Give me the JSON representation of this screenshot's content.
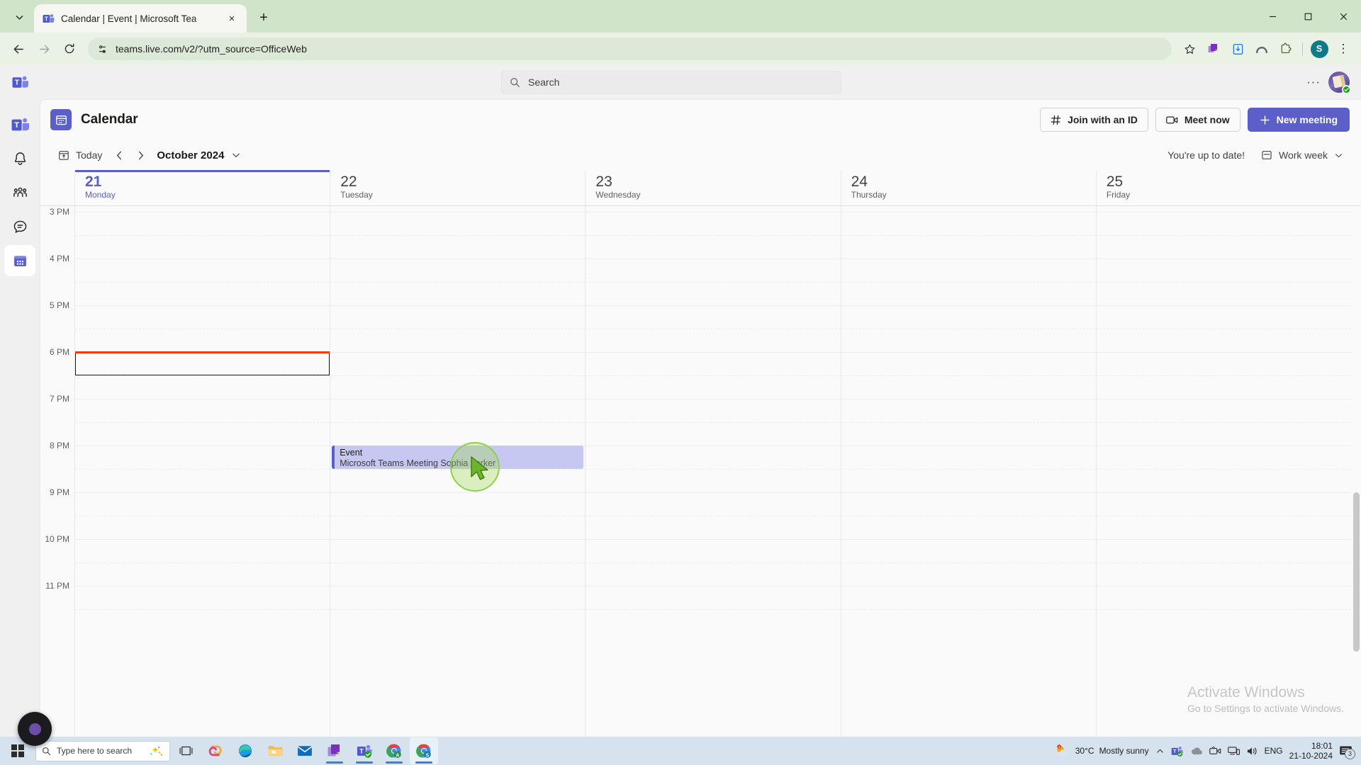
{
  "browser": {
    "tab": {
      "title": "Calendar | Event | Microsoft Tea",
      "favicon": "teams-favicon",
      "close_label": "×"
    },
    "new_tab_label": "+",
    "window_controls": {
      "minimize": "–",
      "maximize": "☐",
      "close": "✕"
    },
    "nav": {
      "back": "back-arrow",
      "forward": "forward-arrow",
      "reload": "reload-icon"
    },
    "omnibox": {
      "url": "teams.live.com/v2/?utm_source=OfficeWeb",
      "site_info_icon": "page-settings-icon"
    },
    "toolbar_icons": [
      "bookmark-star-icon",
      "office-extension-icon",
      "save-to-drive-icon",
      "rainbow-arc-icon",
      "extensions-puzzle-icon"
    ],
    "profile_initial": "S",
    "menu": "⋮"
  },
  "teams": {
    "search": {
      "placeholder": "Search",
      "icon": "search-icon"
    },
    "topbar": {
      "more": "···",
      "avatar": "user-avatar"
    },
    "rail": [
      {
        "name": "teams-logo",
        "label": "Microsoft Teams",
        "active": false
      },
      {
        "name": "activity",
        "label": "Activity",
        "active": false
      },
      {
        "name": "communities",
        "label": "Communities",
        "active": false
      },
      {
        "name": "chat",
        "label": "Chat",
        "active": false
      },
      {
        "name": "calendar",
        "label": "Calendar",
        "active": true
      }
    ],
    "header": {
      "title": "Calendar",
      "icon": "calendar-icon",
      "buttons": [
        {
          "label": "Join with an ID",
          "icon": "hash-icon",
          "style": "secondary"
        },
        {
          "label": "Meet now",
          "icon": "video-icon",
          "style": "secondary"
        },
        {
          "label": "New meeting",
          "icon": "plus-icon",
          "style": "primary"
        }
      ]
    },
    "toolbar": {
      "today_label": "Today",
      "today_icon": "today-calendar-icon",
      "prev_label": "‹",
      "next_label": "›",
      "month_label": "October 2024",
      "month_chevron": "chevron-down-icon",
      "status_text": "You're up to date!",
      "view_label": "Work week",
      "view_icon": "view-layout-icon",
      "view_chevron": "chevron-down-icon"
    },
    "days": [
      {
        "num": "21",
        "name": "Monday",
        "today": true
      },
      {
        "num": "22",
        "name": "Tuesday",
        "today": false
      },
      {
        "num": "23",
        "name": "Wednesday",
        "today": false
      },
      {
        "num": "24",
        "name": "Thursday",
        "today": false
      },
      {
        "num": "25",
        "name": "Friday",
        "today": false
      }
    ],
    "hours": [
      "3 PM",
      "4 PM",
      "5 PM",
      "6 PM",
      "7 PM",
      "8 PM",
      "9 PM",
      "10 PM",
      "11 PM"
    ],
    "events": [
      {
        "title": "Event",
        "subtitle": "Microsoft Teams Meeting  Sophia parker",
        "day_index": 1,
        "start_hour_index": 5,
        "duration_minutes": 30,
        "accent": "#5b5fc7",
        "background": "#c7c8f2"
      }
    ],
    "selection": {
      "day_index": 0,
      "start_hour_index": 3,
      "duration_minutes": 30
    },
    "current_time_indicator": {
      "color": "#e8400c",
      "day_index": 0,
      "hour_index": 3
    }
  },
  "watermark": {
    "title": "Activate Windows",
    "subtitle": "Go to Settings to activate Windows."
  },
  "taskbar": {
    "start": "windows-start-icon",
    "search_placeholder": "Type here to search",
    "search_icon": "search-icon",
    "copilot_icon": "copilot-sparkle-icon",
    "apps": [
      {
        "name": "task-view",
        "running": false
      },
      {
        "name": "copilot",
        "running": false
      },
      {
        "name": "edge",
        "running": false
      },
      {
        "name": "file-explorer",
        "running": false
      },
      {
        "name": "mail",
        "running": false
      },
      {
        "name": "office",
        "running": true
      },
      {
        "name": "teams",
        "running": true
      },
      {
        "name": "chrome-a",
        "running": true
      },
      {
        "name": "chrome-s",
        "running": true
      }
    ],
    "tray": {
      "weather_temp": "30°C",
      "weather_desc": "Mostly sunny",
      "chevron": "show-hidden-icons",
      "icons": [
        "teams-tray-icon",
        "onedrive-icon",
        "meet-now-icon",
        "network-icon",
        "volume-icon"
      ],
      "language": "ENG",
      "time": "18:01",
      "date": "21-10-2024",
      "notification_count": "3"
    }
  }
}
